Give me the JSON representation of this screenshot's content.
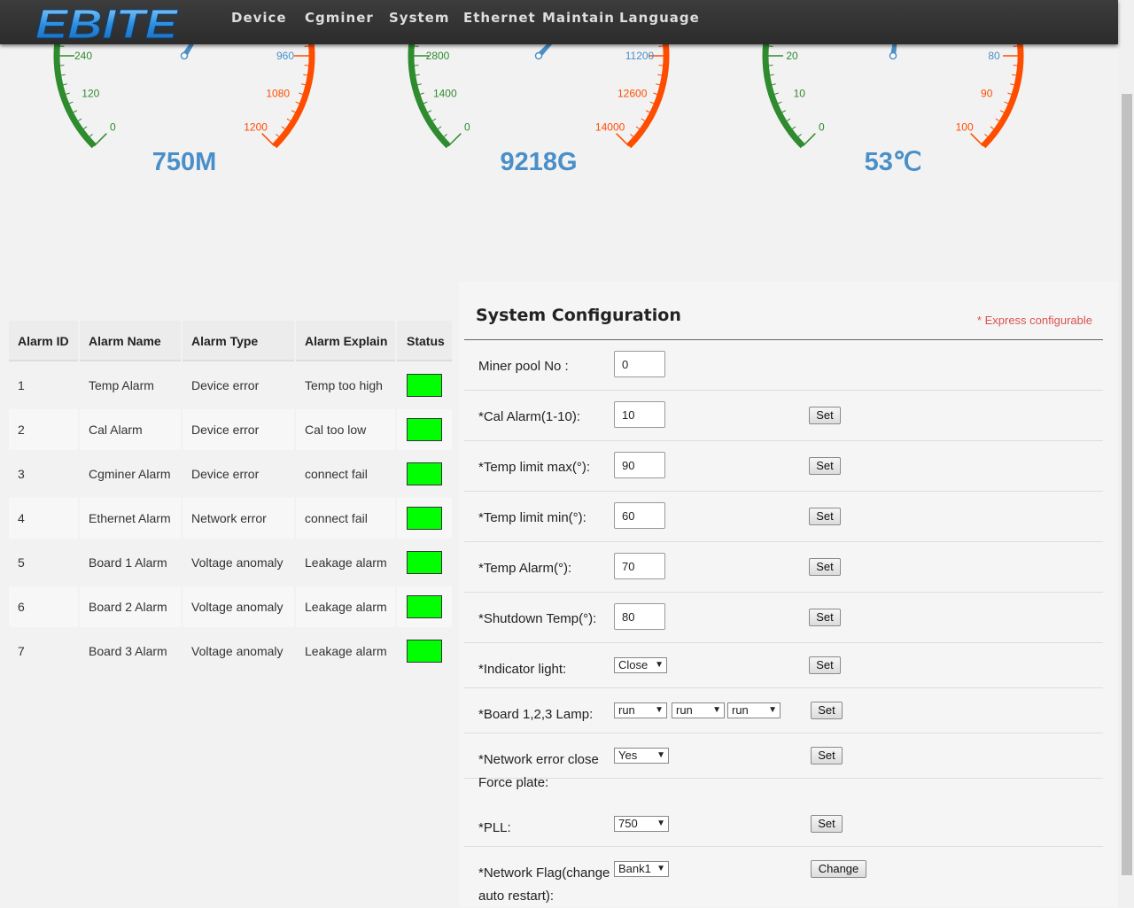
{
  "nav": {
    "logo_text": "EBITE",
    "items": [
      "Device",
      "Cgminer",
      "System",
      "Ethernet",
      "Maintain",
      "Language"
    ]
  },
  "gauges": [
    {
      "name": "frequency",
      "value": "750M",
      "ticks": [
        {
          "label": "0",
          "color": "#2e8b2e"
        },
        {
          "label": "120",
          "color": "#2e8b2e"
        },
        {
          "label": "240",
          "color": "#2e8b2e"
        },
        {
          "label": "960",
          "color": "#4a8fc8"
        },
        {
          "label": "1080",
          "color": "#ff4d00"
        },
        {
          "label": "1200",
          "color": "#ff4d00"
        }
      ],
      "needle_fraction": 0.62
    },
    {
      "name": "hashrate",
      "value": "9218G",
      "ticks": [
        {
          "label": "0",
          "color": "#2e8b2e"
        },
        {
          "label": "1400",
          "color": "#2e8b2e"
        },
        {
          "label": "2800",
          "color": "#2e8b2e"
        },
        {
          "label": "11200",
          "color": "#4a8fc8"
        },
        {
          "label": "12600",
          "color": "#ff4d00"
        },
        {
          "label": "14000",
          "color": "#ff4d00"
        }
      ],
      "needle_fraction": 0.66
    },
    {
      "name": "temperature",
      "value": "53℃",
      "ticks": [
        {
          "label": "0",
          "color": "#2e8b2e"
        },
        {
          "label": "10",
          "color": "#2e8b2e"
        },
        {
          "label": "20",
          "color": "#2e8b2e"
        },
        {
          "label": "80",
          "color": "#4a8fc8"
        },
        {
          "label": "90",
          "color": "#ff4d00"
        },
        {
          "label": "100",
          "color": "#ff4d00"
        }
      ],
      "needle_fraction": 0.53
    }
  ],
  "alarm_table": {
    "headers": [
      "Alarm ID",
      "Alarm Name",
      "Alarm Type",
      "Alarm Explain",
      "Status"
    ],
    "rows": [
      {
        "id": "1",
        "name": "Temp Alarm",
        "type": "Device error",
        "explain": "Temp too high",
        "status_color": "#00ff00"
      },
      {
        "id": "2",
        "name": "Cal Alarm",
        "type": "Device error",
        "explain": "Cal too low",
        "status_color": "#00ff00"
      },
      {
        "id": "3",
        "name": "Cgminer Alarm",
        "type": "Device error",
        "explain": "connect fail",
        "status_color": "#00ff00"
      },
      {
        "id": "4",
        "name": "Ethernet Alarm",
        "type": "Network error",
        "explain": "connect fail",
        "status_color": "#00ff00"
      },
      {
        "id": "5",
        "name": "Board 1 Alarm",
        "type": "Voltage anomaly",
        "explain": "Leakage alarm",
        "status_color": "#00ff00"
      },
      {
        "id": "6",
        "name": "Board 2 Alarm",
        "type": "Voltage anomaly",
        "explain": "Leakage alarm",
        "status_color": "#00ff00"
      },
      {
        "id": "7",
        "name": "Board 3 Alarm",
        "type": "Voltage anomaly",
        "explain": "Leakage alarm",
        "status_color": "#00ff00"
      }
    ]
  },
  "sys_config": {
    "title": "System Configuration",
    "note": "* Express configurable",
    "miner_pool": {
      "label": "Miner pool No :",
      "value": "0"
    },
    "cal_alarm": {
      "label": "*Cal Alarm(1-10):",
      "value": "10",
      "button": "Set"
    },
    "temp_max": {
      "label": "*Temp limit max(°):",
      "value": "90",
      "button": "Set"
    },
    "temp_min": {
      "label": "*Temp limit min(°):",
      "value": "60",
      "button": "Set"
    },
    "temp_alarm": {
      "label": "*Temp Alarm(°):",
      "value": "70",
      "button": "Set"
    },
    "shutdown_temp": {
      "label": "*Shutdown Temp(°):",
      "value": "80",
      "button": "Set"
    },
    "indicator": {
      "label": "*Indicator light:",
      "value": "Close",
      "button": "Set"
    },
    "board_lamp": {
      "label": "*Board 1,2,3 Lamp:",
      "values": [
        "run",
        "run",
        "run"
      ],
      "button": "Set"
    },
    "network_error": {
      "label_line1": "*Network error close",
      "label_line2": "Force plate:",
      "value": "Yes",
      "button": "Set"
    },
    "pll": {
      "label": "*PLL:",
      "value": "750",
      "button": "Set"
    },
    "network_flag": {
      "label_line1": "*Network Flag(change",
      "label_line2": "auto restart):",
      "value": "Bank1",
      "button": "Change"
    }
  },
  "colors": {
    "green": "#2e8b2e",
    "blue": "#4a8fc8",
    "orange": "#ff4d00",
    "status_ok": "#00ff00",
    "accent_note": "#d9534f"
  }
}
